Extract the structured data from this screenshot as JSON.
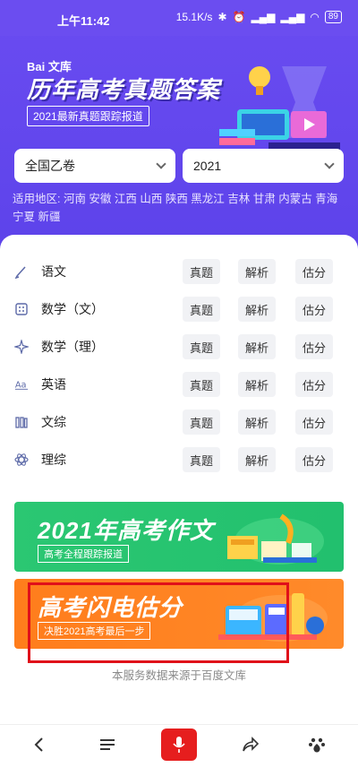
{
  "status": {
    "time": "上午11:42",
    "network_speed": "15.1K/s",
    "battery": "89"
  },
  "hero": {
    "logo": "Bai 文库",
    "title": "历年高考真题答案",
    "subtitle": "2021最新真题跟踪报道"
  },
  "filters": {
    "region": "全国乙卷",
    "year": "2021"
  },
  "regions_text": "适用地区: 河南 安徽 江西 山西 陕西 黑龙江 吉林 甘肃 内蒙古 青海 宁夏 新疆",
  "subjects": [
    {
      "name": "语文",
      "icon": "pen-icon",
      "actions": [
        "真题",
        "解析",
        "估分"
      ]
    },
    {
      "name": "数学（文）",
      "icon": "calculator-icon",
      "actions": [
        "真题",
        "解析",
        "估分"
      ]
    },
    {
      "name": "数学（理）",
      "icon": "sparkle-icon",
      "actions": [
        "真题",
        "解析",
        "估分"
      ]
    },
    {
      "name": "英语",
      "icon": "aa-icon",
      "actions": [
        "真题",
        "解析",
        "估分"
      ]
    },
    {
      "name": "文综",
      "icon": "books-icon",
      "actions": [
        "真题",
        "解析",
        "估分"
      ]
    },
    {
      "name": "理综",
      "icon": "atom-icon",
      "actions": [
        "真题",
        "解析",
        "估分"
      ]
    }
  ],
  "banners": {
    "essay": {
      "title": "2021年高考作文",
      "subtitle": "高考全程跟踪报道"
    },
    "estimate": {
      "title": "高考闪电估分",
      "subtitle": "决胜2021高考最后一步"
    }
  },
  "footnote": "本服务数据来源于百度文库",
  "colors": {
    "hero": "#6a4cf1",
    "green_banner": "#2bc772",
    "orange_banner": "#ff7d1c",
    "highlight": "#e0101a",
    "mic": "#e61e1e"
  }
}
